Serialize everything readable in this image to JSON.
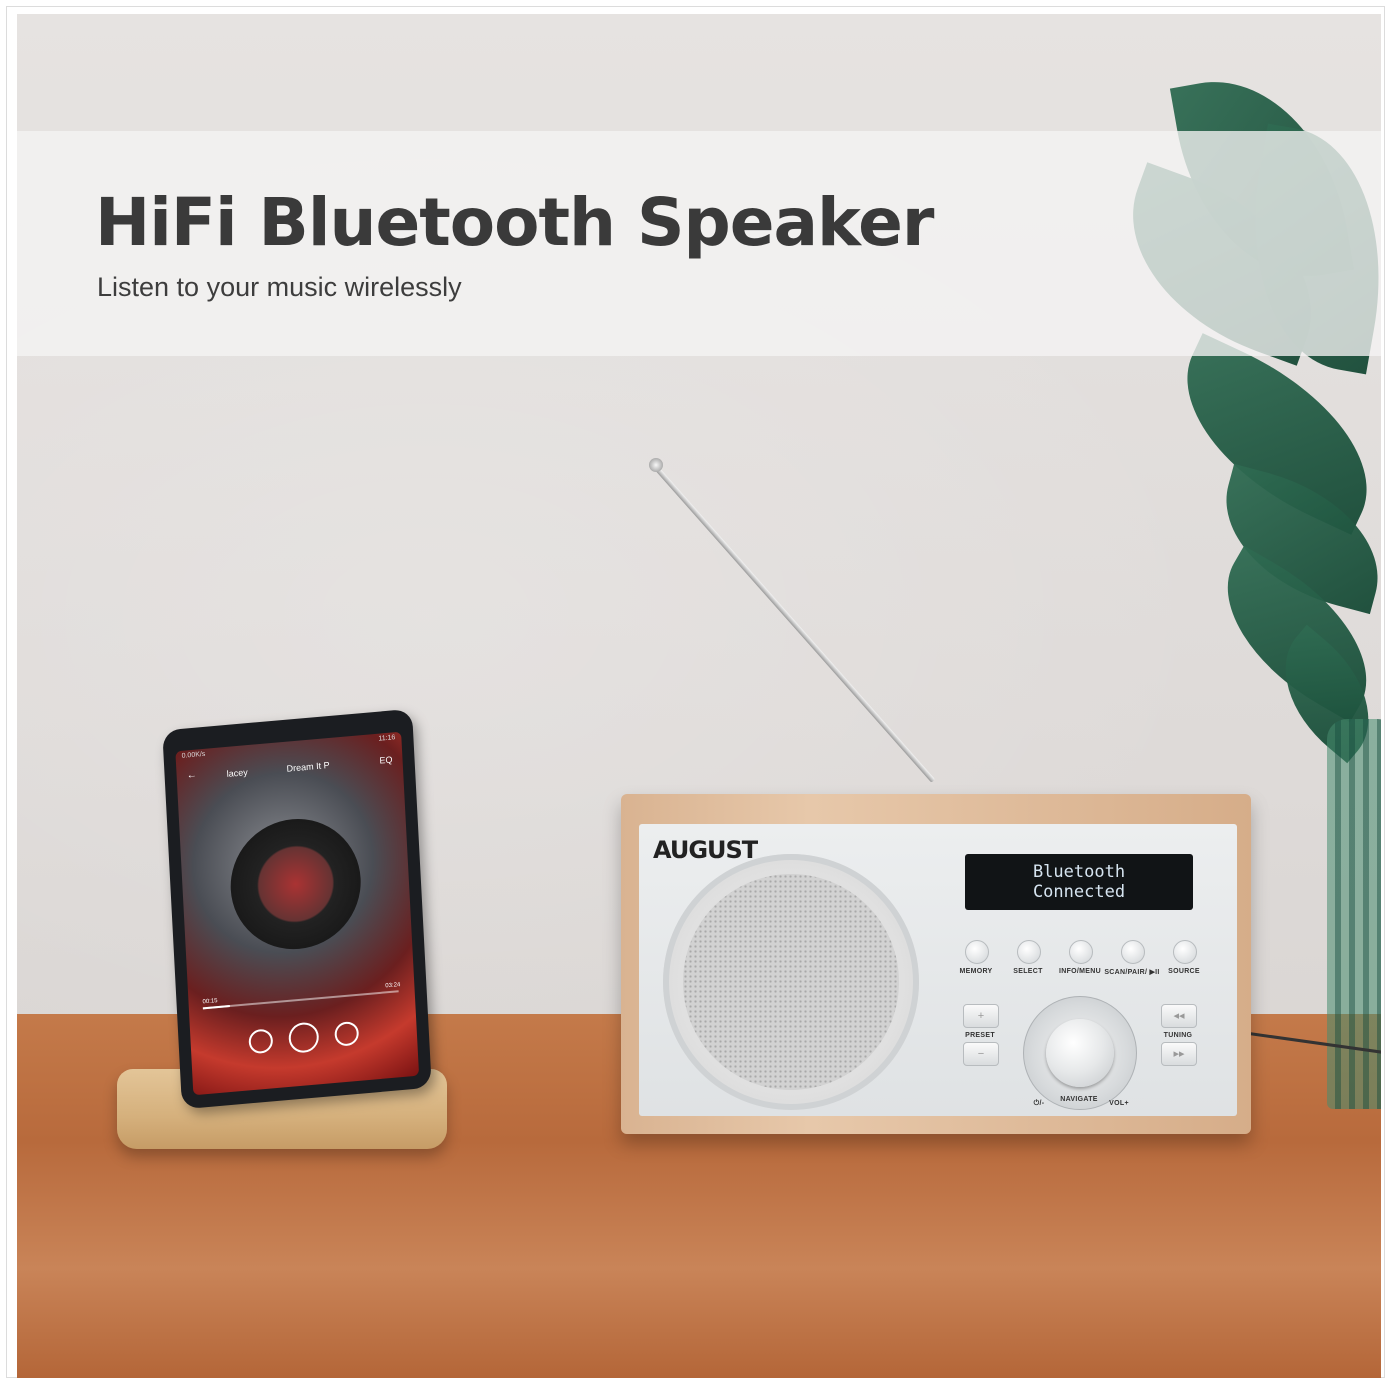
{
  "banner": {
    "title": "HiFi Bluetooth Speaker",
    "subtitle": "Listen to your music wirelessly"
  },
  "radio": {
    "brand": "AUGUST",
    "display_line1": "Bluetooth",
    "display_line2": "Connected",
    "buttons": [
      "MEMORY",
      "SELECT",
      "INFO/MENU",
      "SCAN/PAIR/ ▶II",
      "SOURCE"
    ],
    "labels": {
      "preset": "PRESET",
      "tuning": "TUNING",
      "navigate": "NAVIGATE",
      "power_vol_down": "⏻/-",
      "vol_up": "VOL+"
    }
  },
  "phone": {
    "artist": "lacey",
    "track": "Dream It P",
    "eq": "EQ",
    "status_speed": "0.00K/s",
    "status_time": "11:16",
    "elapsed": "00:15",
    "duration": "03:24",
    "progress": 0.14
  },
  "colors": {
    "wall": "#e2dfdd",
    "table": "#bf7445",
    "wood": "#dfbc9b",
    "plant": "#2a6248",
    "title_text": "#3a3a3a"
  }
}
